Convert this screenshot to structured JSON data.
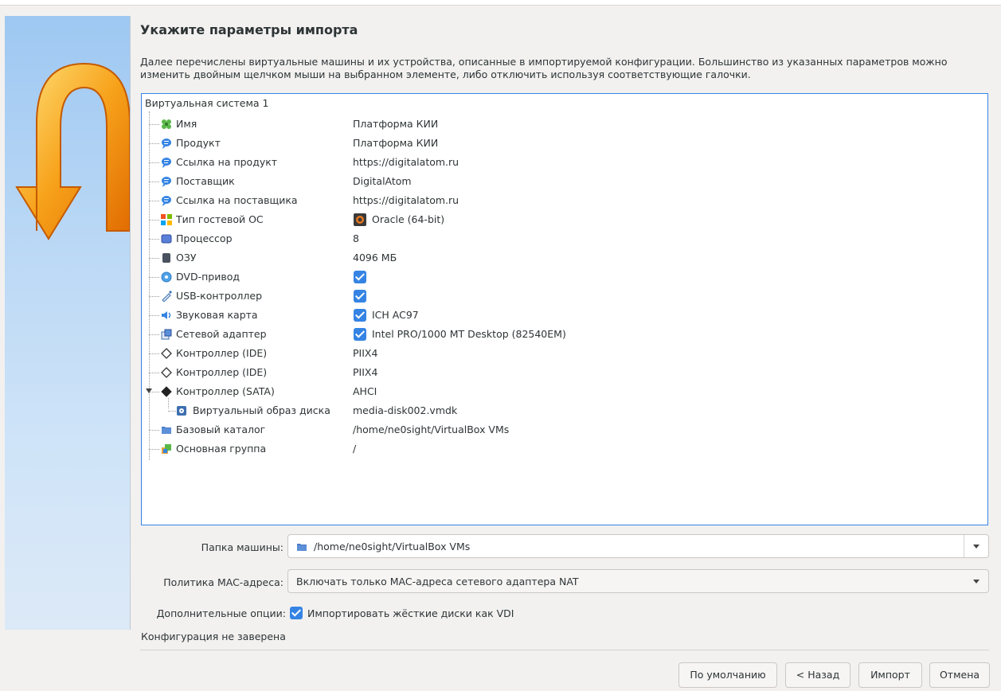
{
  "page": {
    "title": "Укажите параметры импорта",
    "description": "Далее перечислены виртуальные машины и их устройства, описанные в импортируемой конфигурации. Большинство из указанных параметров можно изменить двойным щелчком мыши на выбранном элементе, либо отключить используя соответствующие галочки."
  },
  "tree": {
    "root": "Виртуальная система 1",
    "rows": [
      {
        "label": "Имя",
        "value": "Платформа КИИ",
        "icon": "name-icon"
      },
      {
        "label": "Продукт",
        "value": "Платформа КИИ",
        "icon": "description-icon"
      },
      {
        "label": "Ссылка на продукт",
        "value": "https://digitalatom.ru",
        "icon": "description-icon"
      },
      {
        "label": "Поставщик",
        "value": "DigitalAtom",
        "icon": "description-icon"
      },
      {
        "label": "Ссылка на поставщика",
        "value": "https://digitalatom.ru",
        "icon": "description-icon"
      },
      {
        "label": "Тип гостевой ОС",
        "value": "Oracle (64-bit)",
        "icon": "os-type-icon"
      },
      {
        "label": "Процессор",
        "value": "8",
        "icon": "cpu-icon"
      },
      {
        "label": "ОЗУ",
        "value": "4096 МБ",
        "icon": "ram-icon"
      },
      {
        "label": "DVD-привод",
        "value": "",
        "icon": "dvd-icon",
        "checked": true
      },
      {
        "label": "USB-контроллер",
        "value": "",
        "icon": "usb-icon",
        "checked": true
      },
      {
        "label": "Звуковая карта",
        "value": "ICH AC97",
        "icon": "sound-icon",
        "checked": true
      },
      {
        "label": "Сетевой адаптер",
        "value": "Intel PRO/1000 MT Desktop (82540EM)",
        "icon": "network-icon",
        "checked": true
      },
      {
        "label": "Контроллер (IDE)",
        "value": "PIIX4",
        "icon": "ide-controller-icon"
      },
      {
        "label": "Контроллер (IDE)",
        "value": "PIIX4",
        "icon": "ide-controller-icon"
      },
      {
        "label": "Контроллер (SATA)",
        "value": "AHCI",
        "icon": "sata-controller-icon"
      },
      {
        "label": "Виртуальный образ диска",
        "value": "media-disk002.vmdk",
        "icon": "hard-disk-icon"
      },
      {
        "label": "Базовый каталог",
        "value": "/home/ne0sight/VirtualBox VMs",
        "icon": "folder-icon"
      },
      {
        "label": "Основная группа",
        "value": "/",
        "icon": "group-icon"
      }
    ]
  },
  "form": {
    "machine_folder_label": "Папка машины:",
    "machine_folder_value": "/home/ne0sight/VirtualBox VMs",
    "mac_policy_label": "Политика MAC-адреса:",
    "mac_policy_value": "Включать только MAC-адреса сетевого адаптера NAT",
    "extra_options_label": "Дополнительные опции:",
    "import_vdi_label": "Импортировать жёсткие диски как VDI",
    "status": "Конфигурация не заверена"
  },
  "buttons": {
    "defaults": "По умолчанию",
    "back": "< Назад",
    "import": "Импорт",
    "cancel": "Отмена"
  },
  "colors": {
    "accent": "#3584e4",
    "background": "#f2f1f0"
  }
}
